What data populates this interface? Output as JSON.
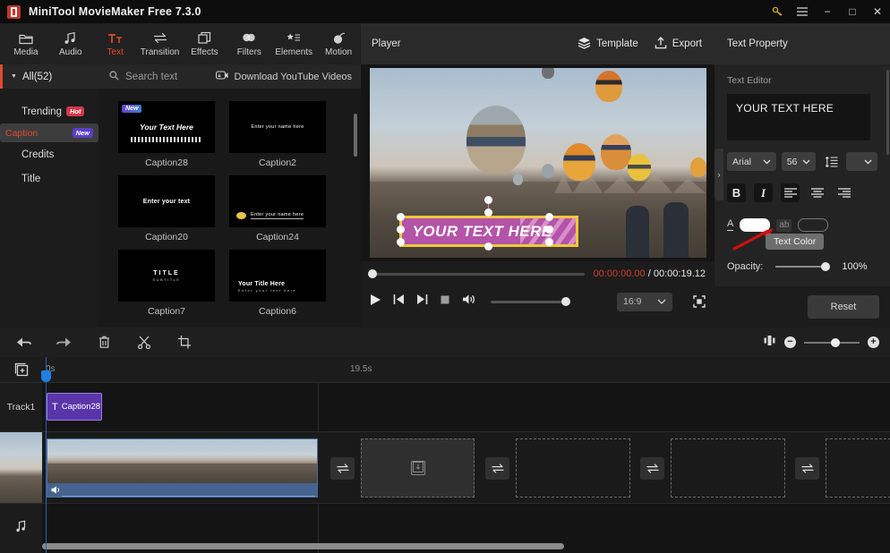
{
  "titlebar": {
    "app_title": "MiniTool MovieMaker Free 7.3.0",
    "key_icon": "key-icon",
    "menu_icon": "hamburger-menu-icon",
    "minimize": "−",
    "maximize": "□",
    "close": "✕"
  },
  "tooltabs": [
    {
      "label": "Media",
      "icon": "folder-icon"
    },
    {
      "label": "Audio",
      "icon": "music-note-icon"
    },
    {
      "label": "Text",
      "icon": "text-tt-icon"
    },
    {
      "label": "Transition",
      "icon": "transition-arrows-icon"
    },
    {
      "label": "Effects",
      "icon": "layers-square-icon"
    },
    {
      "label": "Filters",
      "icon": "droplets-icon"
    },
    {
      "label": "Elements",
      "icon": "star-list-icon"
    },
    {
      "label": "Motion",
      "icon": "motion-ball-icon"
    }
  ],
  "sidebar": {
    "all_label": "All(52)",
    "caret": "▼",
    "items": [
      {
        "label": "Trending",
        "badge": "Hot",
        "badge_kind": "hot"
      },
      {
        "label": "Caption",
        "badge": "New",
        "badge_kind": "new"
      },
      {
        "label": "Credits",
        "badge": "",
        "badge_kind": ""
      },
      {
        "label": "Title",
        "badge": "",
        "badge_kind": ""
      }
    ]
  },
  "browser": {
    "search_placeholder": "Search text",
    "search_icon": "search-icon",
    "download_label": "Download YouTube Videos",
    "download_icon": "youtube-download-icon",
    "templates": [
      {
        "name": "Caption28",
        "preview_text": "Your Text Here",
        "badge": "New",
        "style": "script"
      },
      {
        "name": "Caption2",
        "preview_text": "Enter your name here",
        "badge": "",
        "style": "small"
      },
      {
        "name": "Caption20",
        "preview_text": "Enter your text",
        "badge": "",
        "style": "mid"
      },
      {
        "name": "Caption24",
        "preview_text": "Enter your name here",
        "badge": "",
        "style": "emoji"
      },
      {
        "name": "Caption7",
        "preview_text": "TITLE",
        "preview_sub": "SUBTITLE",
        "badge": "",
        "style": "title"
      },
      {
        "name": "Caption6",
        "preview_text": "Your  Title Here",
        "preview_sub": "Enter your text here",
        "badge": "",
        "style": "titlesub"
      }
    ]
  },
  "player": {
    "title": "Player",
    "template_label": "Template",
    "template_icon": "layers-icon",
    "export_label": "Export",
    "export_icon": "upload-icon",
    "overlay_text": "YOUR TEXT HERE",
    "current_time": "00:00:00.00",
    "separator": "/",
    "total_time": "00:00:19.12",
    "aspect_ratio": "16:9",
    "aspect_caret": "⌄",
    "controls": {
      "play": "play-icon",
      "prev_frame": "previous-frame-icon",
      "next_frame": "next-frame-icon",
      "stop": "stop-icon",
      "volume": "volume-icon",
      "fullscreen": "fullscreen-icon"
    }
  },
  "text_property": {
    "panel_title": "Text Property",
    "editor_label": "Text Editor",
    "editor_value": "YOUR TEXT HERE",
    "font_family": "Arial",
    "font_size": "56",
    "line_spacing_icon": "line-spacing-icon",
    "more_caret": "⌄",
    "bold": "B",
    "italic": "I",
    "align_left": "align-left-icon",
    "align_center": "align-center-icon",
    "align_right": "align-right-icon",
    "text_color_glyph": "A",
    "text_color_hex": "#ffffff",
    "bg_color_glyph": "ab",
    "bg_color_hex": "transparent",
    "tooltip": "Text Color",
    "opacity_label": "Opacity:",
    "opacity_value": "100%",
    "reset_label": "Reset",
    "collapse_caret": "›"
  },
  "edit_toolbar": {
    "undo": "undo-icon",
    "redo": "redo-icon",
    "delete": "trash-icon",
    "split": "scissors-icon",
    "crop": "crop-icon",
    "fit_icon": "fit-timeline-icon",
    "zoom_out": "−",
    "zoom_in": "+"
  },
  "timeline": {
    "time_start": "0s",
    "time_end": "19.5s",
    "add_track_icon": "add-track-icon",
    "track1_label": "Track1",
    "video_track_icon": "film-strip-icon",
    "audio_track_icon": "music-note-icon",
    "text_clip": {
      "name": "Caption28",
      "type_glyph": "T"
    },
    "video_clip_audio_icon": "speaker-icon",
    "transition_icon": "transition-arrows-icon",
    "media_slot_icon": "add-media-icon"
  },
  "colors": {
    "accent_red": "#e04a2f",
    "time_red": "#d03a2c",
    "clip_purple": "#5a35aa",
    "audio_blue": "#44638f",
    "playhead_blue": "#1f7fe0",
    "overlay_magenta": "#b354a8",
    "overlay_yellow": "#f0c83c"
  }
}
